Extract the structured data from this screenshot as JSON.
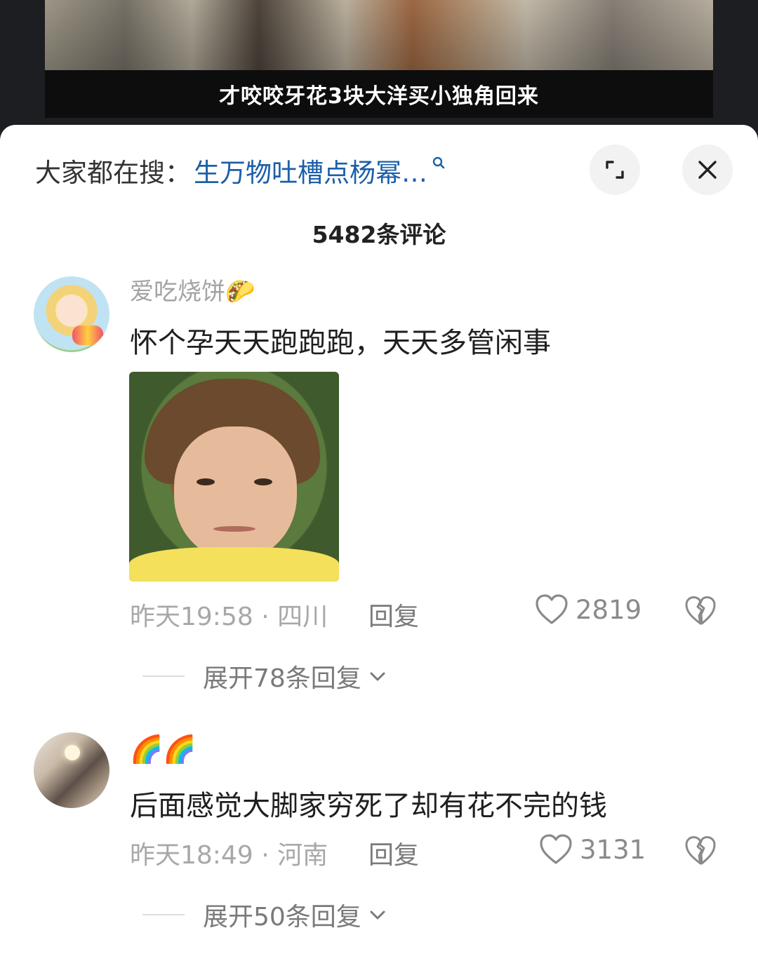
{
  "video": {
    "subtitle": "才咬咬牙花3块大洋买小独角回来"
  },
  "header": {
    "search_label": "大家都在搜：",
    "search_term": "生万物吐槽点杨幂…",
    "icons": {
      "search": "search-icon",
      "expand": "expand-icon",
      "close": "close-icon"
    }
  },
  "comment_count": "5482条评论",
  "comments": [
    {
      "username": "爱吃烧饼🌮",
      "text": "怀个孕天天跑跑跑，天天多管闲事",
      "has_image": true,
      "time": "昨天19:58",
      "location": "四川",
      "reply_label": "回复",
      "likes": "2819",
      "expand_label": "展开78条回复"
    },
    {
      "username": "🌈🌈",
      "text": "后面感觉大脚家穷死了却有花不完的钱",
      "has_image": false,
      "time": "昨天18:49",
      "location": "河南",
      "reply_label": "回复",
      "likes": "3131",
      "expand_label": "展开50条回复"
    }
  ],
  "colors": {
    "search_term": "#1c5fa8",
    "muted_text": "#a8a8a8",
    "body_text": "#1f1f1f"
  }
}
